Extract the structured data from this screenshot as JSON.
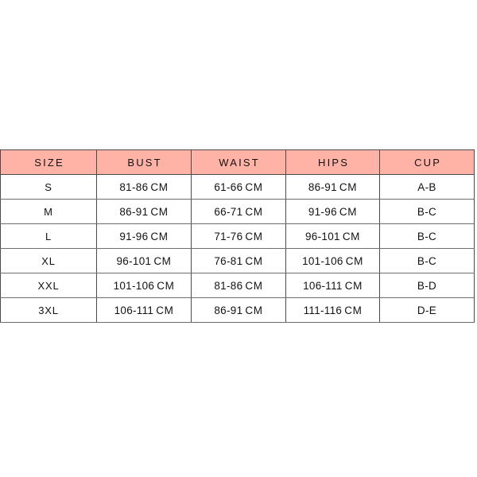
{
  "theme": {
    "header_bg": "#ffb3a7",
    "cell_bg": "#ffffff",
    "border": "#4a4a4a",
    "row_rule": "#6e6e6e",
    "text": "#121212",
    "page_bg": "#ffffff"
  },
  "table": {
    "name": "size-chart",
    "unit": "CM",
    "columns": [
      {
        "key": "size",
        "label": "SIZE"
      },
      {
        "key": "bust",
        "label": "BUST"
      },
      {
        "key": "waist",
        "label": "WAIST"
      },
      {
        "key": "hips",
        "label": "HIPS"
      },
      {
        "key": "cup",
        "label": "CUP"
      }
    ],
    "rows": [
      {
        "size": "S",
        "bust_range": "81-86",
        "bust_unit": "CM",
        "waist_range": "61-66",
        "waist_unit": "CM",
        "hips_range": "86-91",
        "hips_unit": "CM",
        "cup": "A-B"
      },
      {
        "size": "M",
        "bust_range": "86-91",
        "bust_unit": "CM",
        "waist_range": "66-71",
        "waist_unit": "CM",
        "hips_range": "91-96",
        "hips_unit": "CM",
        "cup": "B-C"
      },
      {
        "size": "L",
        "bust_range": "91-96",
        "bust_unit": "CM",
        "waist_range": "71-76",
        "waist_unit": "CM",
        "hips_range": "96-101",
        "hips_unit": "CM",
        "cup": "B-C"
      },
      {
        "size": "XL",
        "bust_range": "96-101",
        "bust_unit": "CM",
        "waist_range": "76-81",
        "waist_unit": "CM",
        "hips_range": "101-106",
        "hips_unit": "CM",
        "cup": "B-C"
      },
      {
        "size": "XXL",
        "bust_range": "101-106",
        "bust_unit": "CM",
        "waist_range": "81-86",
        "waist_unit": "CM",
        "hips_range": "106-111",
        "hips_unit": "CM",
        "cup": "B-D"
      },
      {
        "size": "3XL",
        "bust_range": "106-111",
        "bust_unit": "CM",
        "waist_range": "86-91",
        "waist_unit": "CM",
        "hips_range": "111-116",
        "hips_unit": "CM",
        "cup": "D-E"
      }
    ]
  }
}
